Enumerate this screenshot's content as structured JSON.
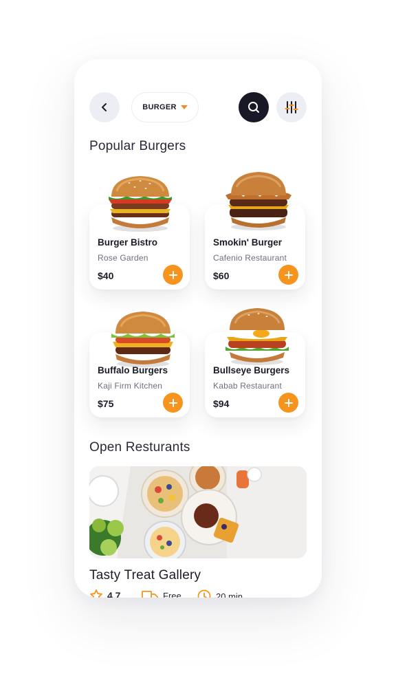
{
  "header": {
    "category": "BURGER"
  },
  "sections": {
    "popular_title": "Popular Burgers",
    "open_title": "Open Resturants"
  },
  "products": [
    {
      "name": "Burger Bistro",
      "restaurant": "Rose Garden",
      "price": "$40"
    },
    {
      "name": "Smokin' Burger",
      "restaurant": "Cafenio Restaurant",
      "price": "$60"
    },
    {
      "name": "Buffalo Burgers",
      "restaurant": "Kaji Firm Kitchen",
      "price": "$75"
    },
    {
      "name": "Bullseye Burgers",
      "restaurant": "Kabab Restaurant",
      "price": "$94"
    }
  ],
  "restaurant": {
    "name": "Tasty Treat Gallery",
    "rating": "4.7",
    "delivery": "Free",
    "time": "20 min"
  },
  "colors": {
    "accent": "#f7941d",
    "dark": "#181827",
    "muted": "#6c6f80",
    "chip": "#eceef3"
  },
  "icons": [
    "back-arrow-icon",
    "caret-down-icon",
    "search-icon",
    "filter-sliders-icon",
    "plus-icon",
    "star-icon",
    "delivery-truck-icon",
    "clock-icon"
  ]
}
